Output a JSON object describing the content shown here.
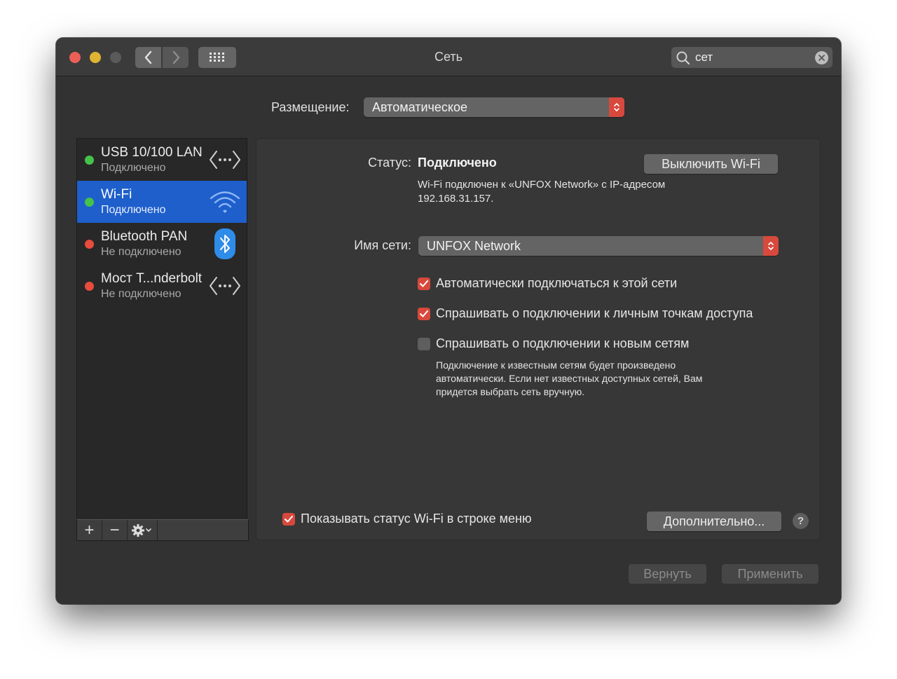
{
  "window": {
    "title": "Сеть",
    "search": {
      "value": "сет"
    }
  },
  "location": {
    "label": "Размещение:",
    "value": "Автоматическое"
  },
  "services": [
    {
      "name": "USB 10/100 LAN",
      "status": "Подключено",
      "state": "connected",
      "icon": "ethernet-arrows-icon",
      "selected": false
    },
    {
      "name": "Wi-Fi",
      "status": "Подключено",
      "state": "connected",
      "icon": "wifi-icon",
      "selected": true
    },
    {
      "name": "Bluetooth PAN",
      "status": "Не подключено",
      "state": "disconnected",
      "icon": "bluetooth-icon",
      "selected": false
    },
    {
      "name": "Мост T...nderbolt",
      "status": "Не подключено",
      "state": "disconnected",
      "icon": "bridge-arrows-icon",
      "selected": false
    }
  ],
  "sidebar_toolbar": {
    "add": "+",
    "remove": "−"
  },
  "detail": {
    "status_label": "Статус:",
    "status_value": "Подключено",
    "status_description_line1": "Wi-Fi подключен к «UNFOX Network» с IP-адресом",
    "status_description_line2": "192.168.31.157.",
    "toggle_wifi_button": "Выключить Wi-Fi",
    "network_name_label": "Имя сети:",
    "network_name_value": "UNFOX Network",
    "options": [
      {
        "label": "Автоматически подключаться к этой сети",
        "checked": true
      },
      {
        "label": "Спрашивать о подключении к личным точкам доступа",
        "checked": true
      },
      {
        "label": "Спрашивать о подключении к новым сетям",
        "checked": false
      }
    ],
    "options_note_line1": "Подключение к известным сетям будет произведено",
    "options_note_line2": "автоматически. Если нет известных доступных сетей, Вам",
    "options_note_line3": "придется выбрать сеть вручную.",
    "show_status_label": "Показывать статус Wi-Fi в строке меню",
    "show_status_checked": true,
    "advanced_button": "Дополнительно...",
    "help": "?"
  },
  "footer": {
    "revert_button": "Вернуть",
    "apply_button": "Применить"
  },
  "colors": {
    "accent_red": "#d8493d",
    "selection_blue": "#1e5fcc",
    "connected_green": "#44c24a",
    "disconnected_red": "#e74c3c",
    "bluetooth_blue": "#2f8ce8"
  }
}
